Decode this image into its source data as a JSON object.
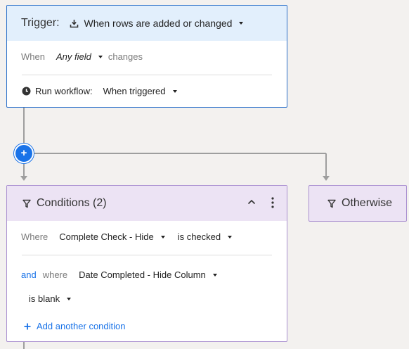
{
  "trigger": {
    "label": "Trigger:",
    "event": "When rows are added or changed",
    "when_label": "When",
    "field": "Any field",
    "changes_label": "changes",
    "run_label": "Run workflow:",
    "run_value": "When triggered"
  },
  "conditions": {
    "title": "Conditions (2)",
    "where_label": "Where",
    "cond1_field": "Complete Check - Hide",
    "cond1_operator": "is checked",
    "and_label": "and",
    "where2_label": "where",
    "cond2_field": "Date Completed - Hide Column",
    "cond2_operator": "is blank",
    "add_condition": "Add another condition"
  },
  "otherwise": {
    "title": "Otherwise"
  },
  "colors": {
    "trigger_border": "#2a6fc9",
    "trigger_header_bg": "#e2effc",
    "condition_border": "#a98fd0",
    "condition_header_bg": "#ece3f4",
    "accent_blue": "#1a73e8"
  },
  "icons": {
    "trigger_event": "upload-tray-icon",
    "run_workflow": "clock-icon",
    "conditions": "filter-icon",
    "collapse": "chevron-up-icon",
    "more": "more-vertical-icon",
    "add": "plus-icon"
  }
}
